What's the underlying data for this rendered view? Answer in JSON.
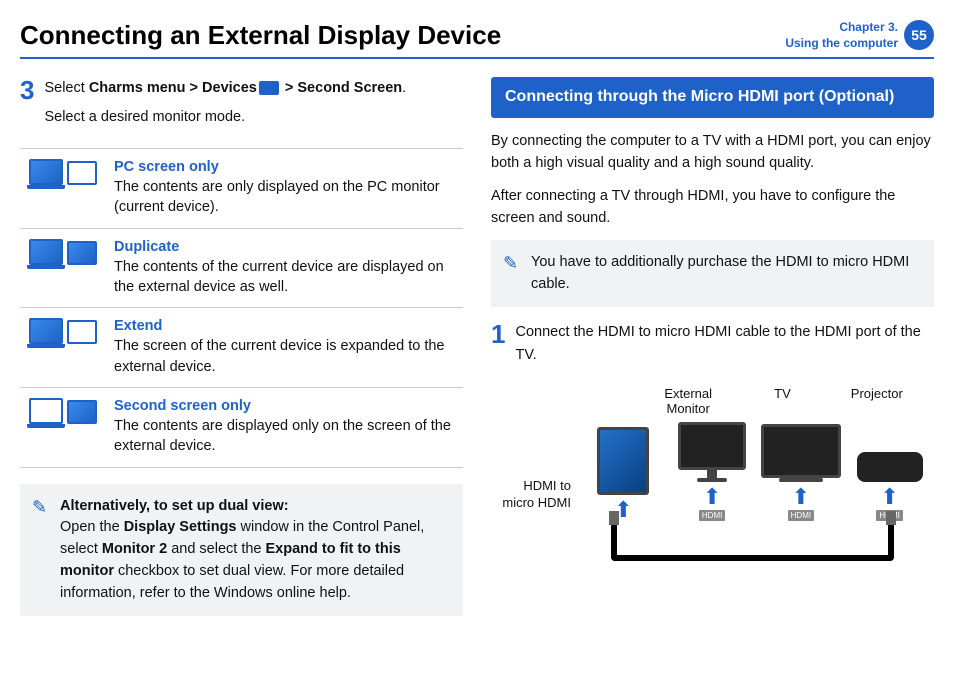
{
  "header": {
    "title": "Connecting an External Display Device",
    "chapter_line1": "Chapter 3.",
    "chapter_line2": "Using the computer",
    "page": "55"
  },
  "left": {
    "step_num": "3",
    "step_line1_a": "Select ",
    "step_line1_b": "Charms menu > Devices",
    "step_line1_c": " > ",
    "step_line1_d": "Second Screen",
    "step_line1_e": ".",
    "step_line2": "Select a desired monitor mode.",
    "modes": [
      {
        "title": "PC  screen  only",
        "desc": "The contents are only displayed on the PC monitor (current device)."
      },
      {
        "title": "Duplicate",
        "desc": "The contents of the current device are displayed on the external device as well."
      },
      {
        "title": "Extend",
        "desc": "The screen of the current device is expanded to the external device."
      },
      {
        "title": "Second screen only",
        "desc": "The contents are displayed only on the screen of the external device."
      }
    ],
    "note_title": "Alternatively, to set up dual view:",
    "note_a": "Open the ",
    "note_b": "Display Settings",
    "note_c": " window in the Control Panel, select ",
    "note_d": "Monitor 2",
    "note_e": " and select the ",
    "note_f": "Expand to fit to this monitor",
    "note_g": " checkbox to set dual view. For more detailed information, refer to the Windows online help."
  },
  "right": {
    "box_title": "Connecting through the Micro HDMI port (Optional)",
    "p1": "By connecting the computer to a TV with a HDMI port, you can enjoy both a high visual quality and a high sound quality.",
    "p2": "After connecting a TV through HDMI, you have to configure the screen and sound.",
    "note": "You have to additionally purchase the HDMI to micro HDMI cable.",
    "step_num": "1",
    "step_text": "Connect the HDMI to micro HDMI cable to the HDMI port of the TV.",
    "labels": {
      "ext": "External Monitor",
      "tv": "TV",
      "proj": "Projector",
      "cable": "HDMI to micro HDMI",
      "port": "HDMI"
    }
  }
}
